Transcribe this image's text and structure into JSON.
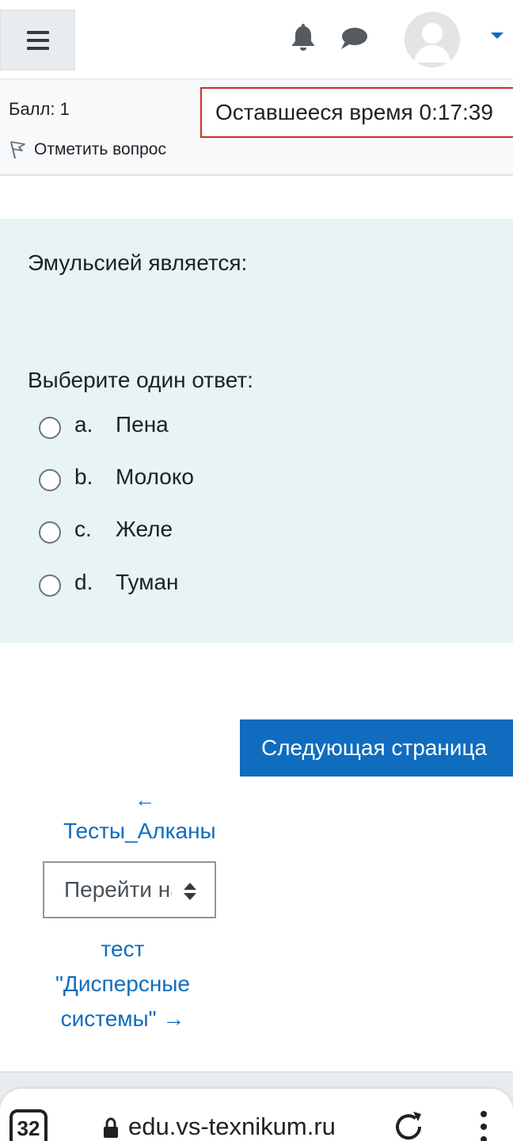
{
  "navbar": {
    "menu_icon": "hamburger-icon",
    "notifications_icon": "bell-icon",
    "messages_icon": "chat-icon",
    "avatar_icon": "user-avatar",
    "dropdown_icon": "caret-down-icon",
    "accent_color": "#0f6cbf"
  },
  "quiz_info": {
    "grade": "Балл: 1",
    "timer": "Оставшееся время 0:17:39",
    "flag_label": "Отметить вопрос",
    "flag_icon": "flag-icon"
  },
  "question": {
    "text": "Эмульсией является:",
    "prompt": "Выберите один ответ:",
    "answers": [
      {
        "letter": "a.",
        "text": "Пена",
        "selected": false
      },
      {
        "letter": "b.",
        "text": "Молоко",
        "selected": false
      },
      {
        "letter": "c.",
        "text": "Желе",
        "selected": false
      },
      {
        "letter": "d.",
        "text": "Туман",
        "selected": false
      }
    ]
  },
  "navigation": {
    "next_page": "Следующая страница",
    "prev_arrow": "←",
    "prev_link": "Тесты_Алканы",
    "jump_select": "Перейти на...",
    "next_link_lines": [
      "тест",
      "\"Дисперсные",
      "системы\" →"
    ]
  },
  "browser": {
    "tab_count": "32",
    "url": "edu.vs-texnikum.ru",
    "lock_icon": "lock-icon",
    "reload_icon": "reload-icon",
    "menu_icon": "kebab-menu-icon"
  }
}
